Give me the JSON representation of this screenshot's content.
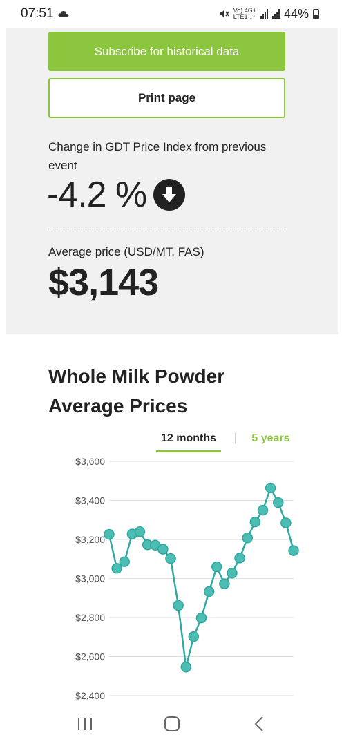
{
  "status_bar": {
    "time": "07:51",
    "battery": "44%",
    "network_top": "Vo) 4G+",
    "network_bottom": "LTE1 ↓↑"
  },
  "actions": {
    "subscribe_label": "Subscribe for historical data",
    "print_label": "Print page"
  },
  "change": {
    "label": "Change in GDT Price Index from previous event",
    "value": "-4.2 %",
    "direction_icon": "arrow-down-circle-icon"
  },
  "average": {
    "label": "Average price (USD/MT, FAS)",
    "value": "$3,143"
  },
  "chart_section": {
    "title": "Whole Milk Powder Average Prices",
    "tabs": [
      {
        "label": "12 months",
        "active": true
      },
      {
        "label": "5 years",
        "active": false
      }
    ]
  },
  "chart_data": {
    "type": "line",
    "title": "Whole Milk Powder Average Prices",
    "xlabel": "",
    "ylabel": "",
    "y_ticks": [
      "$3,600",
      "$3,400",
      "$3,200",
      "$3,000",
      "$2,800",
      "$2,600",
      "$2,400"
    ],
    "ylim": [
      2400,
      3600
    ],
    "grid": true,
    "series": [
      {
        "values": [
          3226,
          3052,
          3086,
          3228,
          3240,
          3173,
          3171,
          3150,
          3102,
          2862,
          2546,
          2702,
          2798,
          2933,
          3060,
          2973,
          3028,
          3105,
          3208,
          3290,
          3350,
          3464,
          3389,
          3285,
          3143
        ]
      }
    ],
    "colors": {
      "line": "#2fa8a0",
      "marker": "#4cbdb3",
      "grid": "#dddddd"
    }
  },
  "nav_bar": {
    "icons": [
      "recent-apps-icon",
      "home-icon",
      "back-icon"
    ]
  },
  "colors": {
    "accent": "#8cc63f",
    "panel_bg": "#f1f1f1",
    "text": "#222222"
  }
}
